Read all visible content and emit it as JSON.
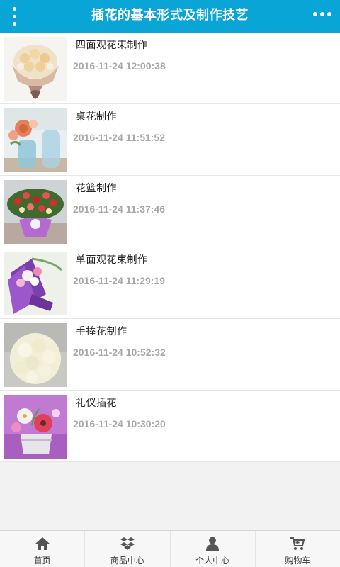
{
  "header": {
    "title": "插花的基本形式及制作技艺",
    "menu_icon": "vertical-dots-icon",
    "more_icon": "horizontal-dots-icon",
    "background": "#08a5d6"
  },
  "articles": [
    {
      "title": "四面观花束制作",
      "time": "2016-11-24 12:00:38",
      "image": "round-bouquet-photo"
    },
    {
      "title": "桌花制作",
      "time": "2016-11-24 11:51:52",
      "image": "table-flower-vase-photo"
    },
    {
      "title": "花篮制作",
      "time": "2016-11-24 11:37:46",
      "image": "flower-basket-photo"
    },
    {
      "title": "单面观花束制作",
      "time": "2016-11-24 11:29:19",
      "image": "one-sided-bouquet-photo"
    },
    {
      "title": "手捧花制作",
      "time": "2016-11-24 10:52:32",
      "image": "bridal-bouquet-photo"
    },
    {
      "title": "礼仪插花",
      "time": "2016-11-24 10:30:20",
      "image": "gerbera-arrangement-photo"
    }
  ],
  "tabbar": [
    {
      "label": "首页",
      "icon": "home-icon"
    },
    {
      "label": "商品中心",
      "icon": "products-icon"
    },
    {
      "label": "个人中心",
      "icon": "user-icon"
    },
    {
      "label": "购物车",
      "icon": "cart-icon"
    }
  ]
}
